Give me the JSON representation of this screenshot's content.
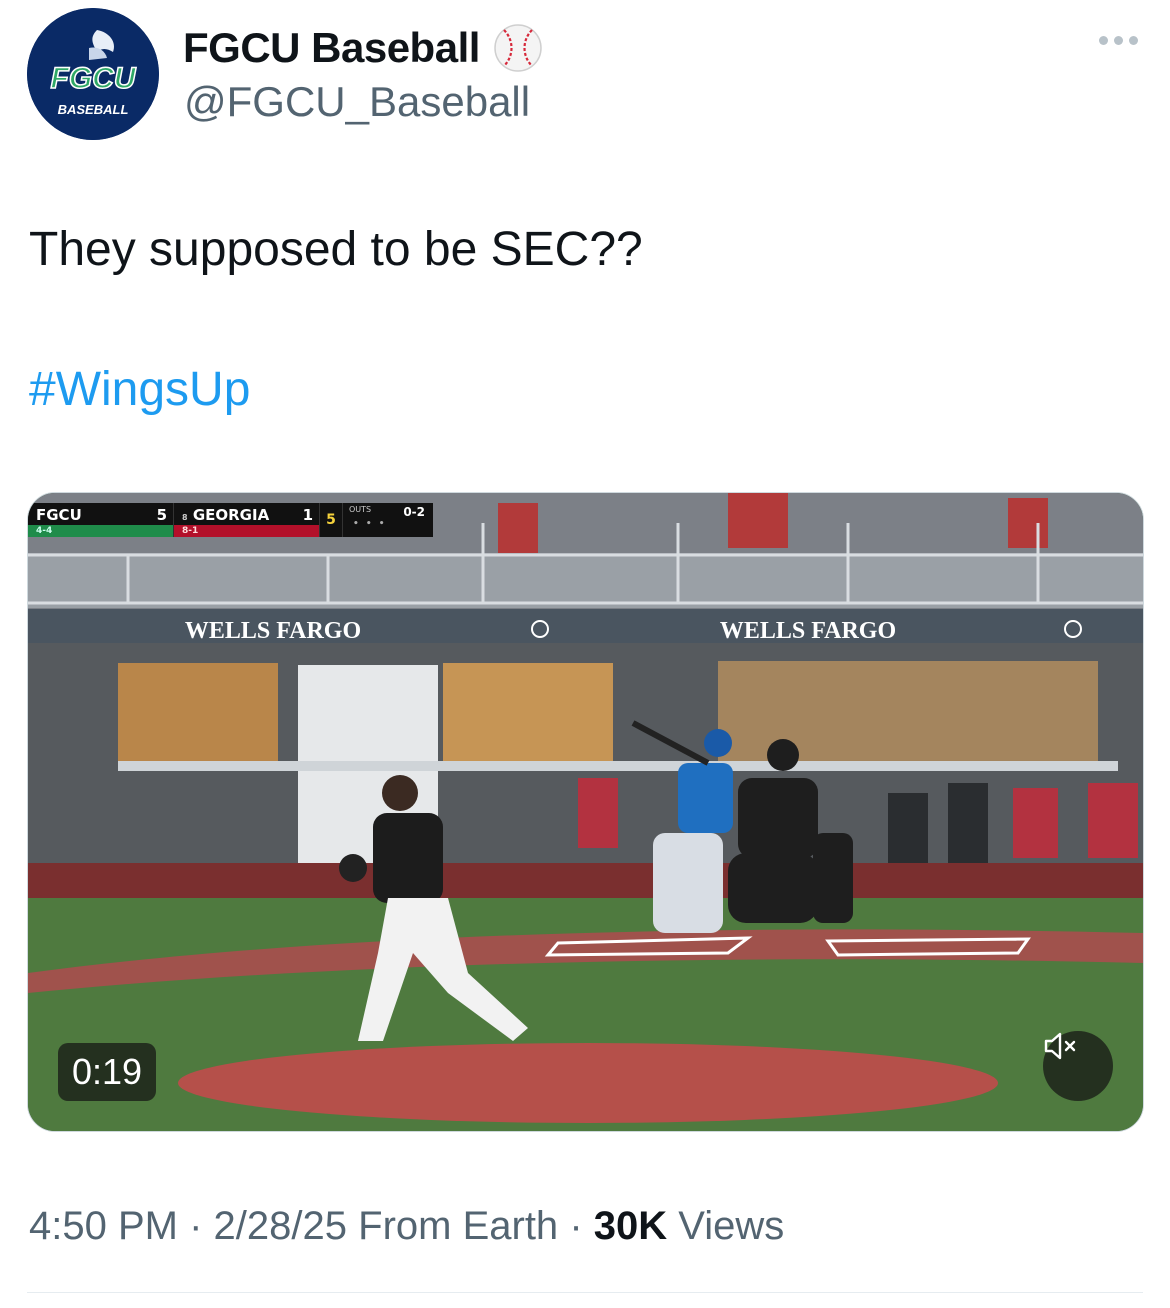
{
  "account": {
    "display_name": "FGCU Baseball",
    "handle": "@FGCU_Baseball",
    "avatar_text": "FGCU",
    "avatar_subtext": "BASEBALL",
    "verified_icon": "baseball-emoji"
  },
  "tweet": {
    "text": "They supposed to be SEC??",
    "hashtag": "#WingsUp"
  },
  "media": {
    "duration": "0:19",
    "muted": true,
    "scorebug": {
      "away_team": "FGCU",
      "away_score": "5",
      "away_record": "4-4",
      "home_rank": "8",
      "home_team": "GEORGIA",
      "home_score": "1",
      "home_record": "8-1",
      "inning": "5",
      "outs_label": "OUTS",
      "count": "0-2",
      "outs_dots": "• • •"
    },
    "banner_text_left": "WELLS FARGO",
    "banner_text_right": "WELLS FARGO"
  },
  "meta": {
    "time": "4:50 PM",
    "separator": "·",
    "date": "2/28/25",
    "source": "From Earth",
    "views_count": "30K",
    "views_label": "Views"
  },
  "colors": {
    "link": "#1d9bf0",
    "secondary_text": "#536471",
    "avatar_bg": "#0a2a66"
  }
}
